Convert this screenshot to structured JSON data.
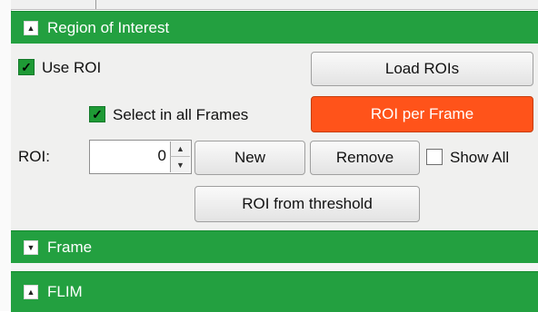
{
  "sections": {
    "roi": {
      "title": "Region of Interest",
      "toggle_glyph": "▲"
    },
    "frame": {
      "title": "Frame",
      "toggle_glyph": "▼"
    },
    "flim": {
      "title": "FLIM",
      "toggle_glyph": "▲"
    }
  },
  "roi_panel": {
    "use_roi": {
      "label": "Use ROI",
      "checked": true
    },
    "select_all_frames": {
      "label": "Select in all Frames",
      "checked": true
    },
    "show_all": {
      "label": "Show All",
      "checked": false
    },
    "load_rois_label": "Load ROIs",
    "roi_per_frame_label": "ROI per Frame",
    "roi_label": "ROI:",
    "roi_value": "0",
    "new_label": "New",
    "remove_label": "Remove",
    "roi_from_threshold_label": "ROI from threshold",
    "icons": {
      "spin_up": "▲",
      "spin_down": "▼",
      "check": "✓"
    }
  },
  "colors": {
    "header": "#23a040",
    "accent_button": "#ff531a"
  }
}
